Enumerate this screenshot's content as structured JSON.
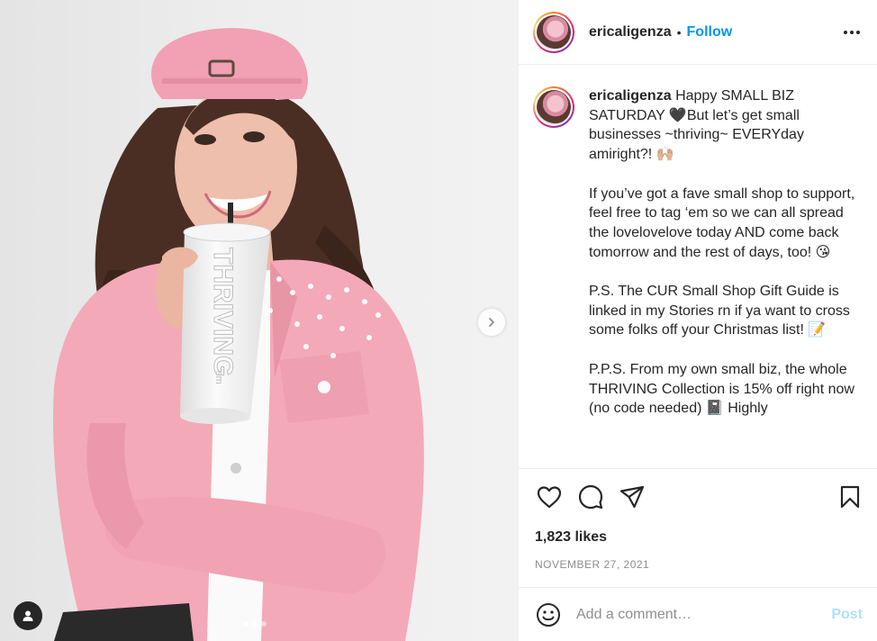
{
  "post": {
    "username": "ericaligenza",
    "separator": "•",
    "follow_label": "Follow",
    "caption": "Happy SMALL BIZ SATURDAY 🖤But let’s get small businesses ~thriving~ EVERYday amiright?! 🙌🏼\n\nIf you’ve got a fave small shop to support, feel free to tag ‘em so we can all spread the lovelovelove today AND come back tomorrow and the rest of days, too! 😘\n\nP.S. The CUR Small Shop Gift Guide is linked in my Stories rn if ya want to cross some folks off your Christmas list! 📝\n\nP.P.S. From my own small biz, the whole THRIVING Collection is 15% off right now (no code needed) 📓 Highly",
    "likes": "1,823 likes",
    "date": "NOVEMBER 27, 2021"
  },
  "media": {
    "tumbler_text": "THRIVING",
    "tumbler_brand": "sm",
    "carousel_count": 3,
    "carousel_active": 0
  },
  "comment": {
    "placeholder": "Add a comment…",
    "post_label": "Post"
  },
  "icons": {
    "more": "more-horizontal-icon",
    "like": "heart-icon",
    "comment": "comment-icon",
    "share": "send-icon",
    "save": "bookmark-icon",
    "emoji": "emoji-icon",
    "next": "chevron-right-icon",
    "tag": "user-tag-icon"
  },
  "colors": {
    "link": "#0095f6",
    "post_disabled": "#b2dffc",
    "jacket": "#f4a9b8",
    "cap": "#f2a0b3"
  }
}
